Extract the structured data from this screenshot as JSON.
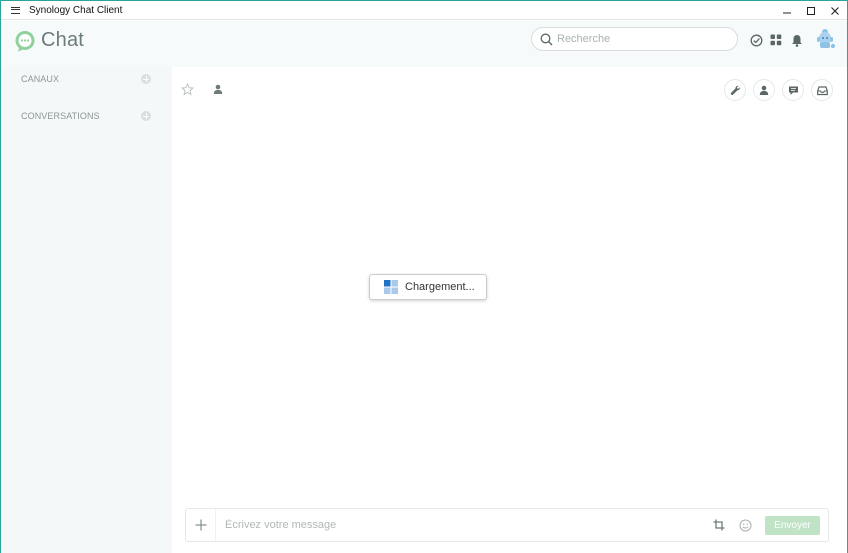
{
  "window": {
    "title": "Synology Chat Client"
  },
  "header": {
    "app_name": "Chat",
    "search_placeholder": "Recherche"
  },
  "sidebar": {
    "sections": [
      {
        "label": "CANAUX"
      },
      {
        "label": "CONVERSATIONS"
      }
    ]
  },
  "main": {
    "loading_text": "Chargement..."
  },
  "composer": {
    "placeholder": "Écrivez votre message",
    "send_label": "Envoyer"
  },
  "colors": {
    "accent": "#2aa59a",
    "logo_green": "#8fd19e",
    "send_disabled": "#bfe3c4",
    "sidebar_bg": "#f4f8f8"
  },
  "icons": {
    "title_menu": "hamburger-icon",
    "minimize": "minimize-icon",
    "maximize": "maximize-icon",
    "close": "close-icon",
    "search": "search-icon",
    "tasks": "check-circle-icon",
    "apps": "grid-icon",
    "notifications": "bell-icon",
    "favorite": "star-icon",
    "members": "person-icon",
    "settings": "wrench-icon",
    "profile": "person-icon",
    "messages": "chat-bubble-icon",
    "inbox": "inbox-icon",
    "add": "plus-icon",
    "crop": "crop-icon",
    "emoji": "smiley-icon"
  }
}
